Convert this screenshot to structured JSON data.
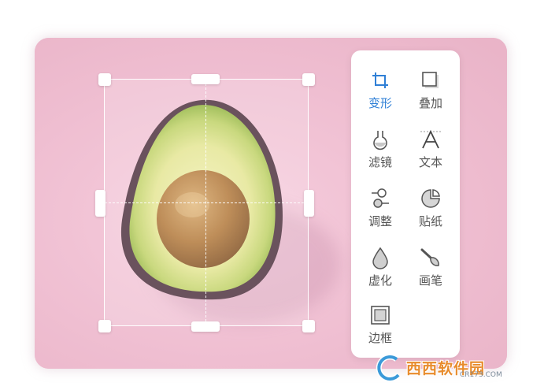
{
  "tools": [
    {
      "id": "transform",
      "label": "变形",
      "icon": "crop-icon",
      "active": true
    },
    {
      "id": "overlay",
      "label": "叠加",
      "icon": "overlay-icon",
      "active": false
    },
    {
      "id": "filter",
      "label": "滤镜",
      "icon": "flask-icon",
      "active": false
    },
    {
      "id": "text",
      "label": "文本",
      "icon": "text-icon",
      "active": false
    },
    {
      "id": "adjust",
      "label": "调整",
      "icon": "adjust-icon",
      "active": false
    },
    {
      "id": "sticker",
      "label": "贴纸",
      "icon": "sticker-icon",
      "active": false
    },
    {
      "id": "blur",
      "label": "虚化",
      "icon": "drop-icon",
      "active": false
    },
    {
      "id": "brush",
      "label": "画笔",
      "icon": "brush-icon",
      "active": false
    },
    {
      "id": "border",
      "label": "边框",
      "icon": "frame-icon",
      "active": false
    }
  ],
  "watermark": {
    "text": "西西软件园",
    "sub": "CR173.COM"
  },
  "colors": {
    "accent": "#2f7fd6",
    "background": "#eebfd0"
  }
}
